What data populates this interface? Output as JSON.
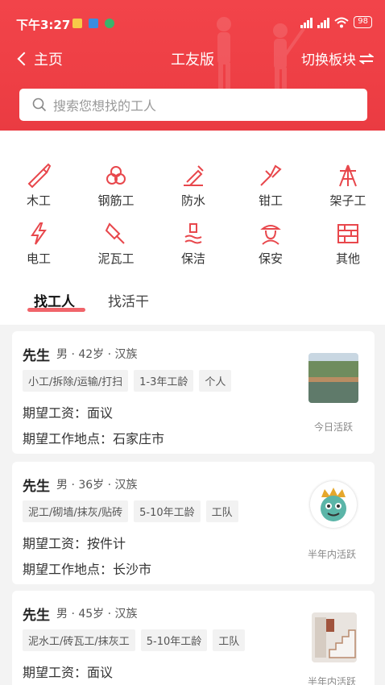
{
  "status": {
    "time": "下午3:27",
    "battery": "98"
  },
  "nav": {
    "back_label": "主页",
    "title": "工友版",
    "switch_label": "切换板块"
  },
  "search": {
    "placeholder": "搜索您想找的工人"
  },
  "categories": [
    {
      "label": "木工",
      "icon": "saw-icon"
    },
    {
      "label": "钢筋工",
      "icon": "rebar-icon"
    },
    {
      "label": "防水",
      "icon": "waterproof-icon"
    },
    {
      "label": "钳工",
      "icon": "pliers-icon"
    },
    {
      "label": "架子工",
      "icon": "scaffold-icon"
    },
    {
      "label": "电工",
      "icon": "lightning-icon"
    },
    {
      "label": "泥瓦工",
      "icon": "trowel-icon"
    },
    {
      "label": "保洁",
      "icon": "cleaning-icon"
    },
    {
      "label": "保安",
      "icon": "guard-icon"
    },
    {
      "label": "其他",
      "icon": "brick-icon"
    }
  ],
  "tabs": {
    "find_worker": "找工人",
    "find_job": "找活干"
  },
  "workers": [
    {
      "name": "先生",
      "meta": "男 · 42岁 · 汉族",
      "tags": [
        "小工/拆除/运输/打扫",
        "1-3年工龄",
        "个人"
      ],
      "wage": "期望工资：面议",
      "location": "期望工作地点：石家庄市",
      "activity": "今日活跃"
    },
    {
      "name": "先生",
      "meta": "男 · 36岁 · 汉族",
      "tags": [
        "泥工/砌墙/抹灰/贴砖",
        "5-10年工龄",
        "工队"
      ],
      "wage": "期望工资：按件计",
      "location": "期望工作地点：长沙市",
      "activity": "半年内活跃"
    },
    {
      "name": "先生",
      "meta": "男 · 45岁 · 汉族",
      "tags": [
        "泥水工/砖瓦工/抹灰工",
        "5-10年工龄",
        "工队"
      ],
      "wage": "期望工资：面议",
      "location": "",
      "activity": "半年内活跃"
    }
  ],
  "colors": {
    "brand_red": "#ee3f45",
    "icon_red": "#e8474c"
  }
}
